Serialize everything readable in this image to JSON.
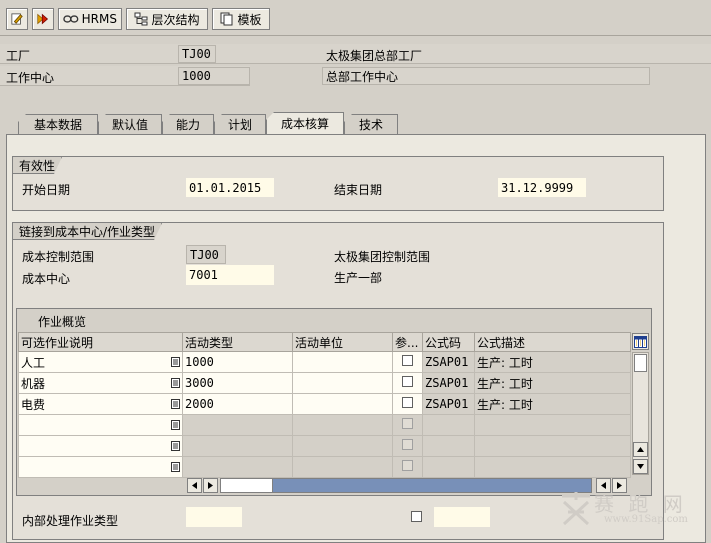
{
  "toolbar": {
    "hrms_label": "HRMS",
    "hierarchy_label": "层次结构",
    "template_label": "模板"
  },
  "header": {
    "plant_label": "工厂",
    "plant_value": "TJ00",
    "plant_desc": "太极集团总部工厂",
    "workcenter_label": "工作中心",
    "workcenter_value": "1000",
    "workcenter_desc": "总部工作中心"
  },
  "tabs": [
    {
      "label": "基本数据"
    },
    {
      "label": "默认值"
    },
    {
      "label": "能力"
    },
    {
      "label": "计划"
    },
    {
      "label": "成本核算"
    },
    {
      "label": "技术"
    }
  ],
  "validity": {
    "title": "有效性",
    "start_label": "开始日期",
    "start_value": "01.01.2015",
    "end_label": "结束日期",
    "end_value": "31.12.9999"
  },
  "link": {
    "title": "链接到成本中心/作业类型",
    "ca_label": "成本控制范围",
    "ca_value": "TJ00",
    "ca_desc": "太极集团控制范围",
    "cc_label": "成本中心",
    "cc_value": "7001",
    "cc_desc": "生产一部"
  },
  "activity": {
    "title": "作业概览",
    "columns": [
      "可选作业说明",
      "活动类型",
      "活动单位",
      "参...",
      "公式码",
      "公式描述"
    ],
    "rows": [
      {
        "desc": "人工",
        "type": "1000",
        "unit": "",
        "formula": "ZSAP01",
        "formula_desc": "生产: 工时"
      },
      {
        "desc": "机器",
        "type": "3000",
        "unit": "",
        "formula": "ZSAP01",
        "formula_desc": "生产: 工时"
      },
      {
        "desc": "电费",
        "type": "2000",
        "unit": "",
        "formula": "ZSAP01",
        "formula_desc": "生产: 工时"
      },
      {
        "desc": "",
        "type": "",
        "unit": "",
        "formula": "",
        "formula_desc": ""
      },
      {
        "desc": "",
        "type": "",
        "unit": "",
        "formula": "",
        "formula_desc": ""
      },
      {
        "desc": "",
        "type": "",
        "unit": "",
        "formula": "",
        "formula_desc": ""
      }
    ]
  },
  "internal": {
    "label": "内部处理作业类型"
  },
  "watermark": {
    "text": "赛 跑 网",
    "url": "www.91Sap.com"
  }
}
